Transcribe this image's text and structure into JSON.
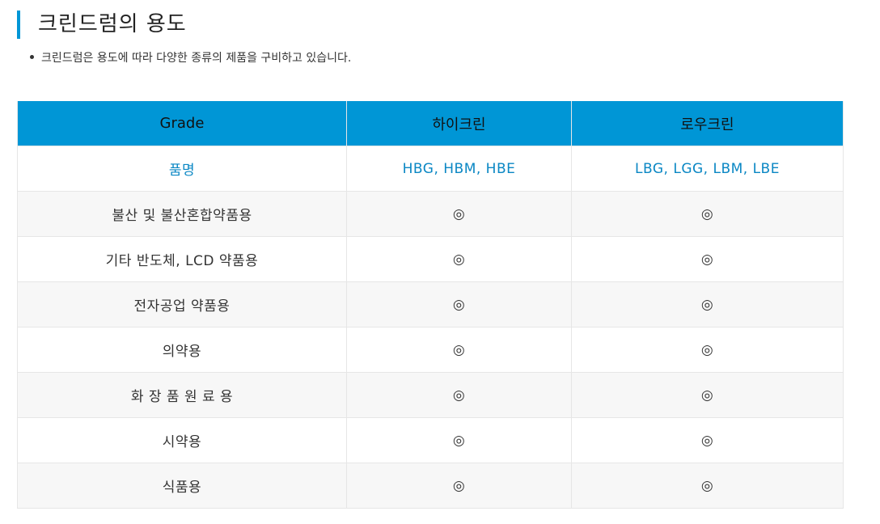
{
  "section": {
    "title": "크린드럼의 용도",
    "bullet": "크린드럼은 용도에 따라 다양한 종류의 제품을 구비하고 있습니다."
  },
  "table": {
    "headers": [
      "Grade",
      "하이크린",
      "로우크린"
    ],
    "product_row": {
      "label": "품명",
      "high": "HBG, HBM, HBE",
      "low": "LBG, LGG, LBM, LBE"
    },
    "rows": [
      {
        "label": "불산 및 불산혼합약품용",
        "high": "◎",
        "low": "◎"
      },
      {
        "label": "기타 반도체, LCD 약품용",
        "high": "◎",
        "low": "◎"
      },
      {
        "label": "전자공업 약품용",
        "high": "◎",
        "low": "◎"
      },
      {
        "label": "의약용",
        "high": "◎",
        "low": "◎"
      },
      {
        "label": "화 장 품 원 료 용",
        "high": "◎",
        "low": "◎"
      },
      {
        "label": "시약용",
        "high": "◎",
        "low": "◎"
      },
      {
        "label": "식품용",
        "high": "◎",
        "low": "◎"
      }
    ]
  },
  "colors": {
    "accent": "#0096d6",
    "link_text": "#0a87c4",
    "alt_row": "#f7f7f7"
  }
}
